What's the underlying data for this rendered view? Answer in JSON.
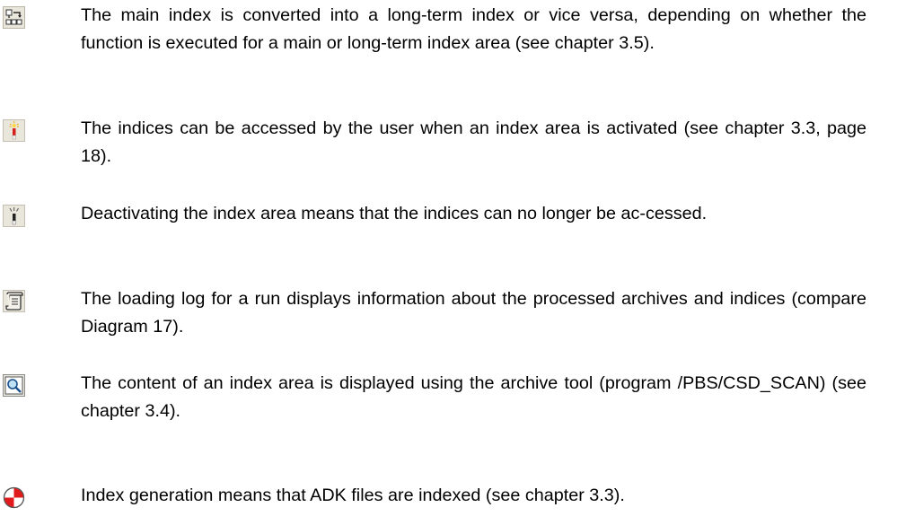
{
  "entries": [
    {
      "icon": "convert-index-icon",
      "text": "The main index is converted into a long-term index or vice versa, depending on whether the function is executed for a main or long-term index area (see chapter 3.5)."
    },
    {
      "icon": "activate-icon",
      "text": "The indices can be accessed by the user when an index area is activated (see chapter 3.3, page 18)."
    },
    {
      "icon": "deactivate-icon",
      "text": "Deactivating the index area means that the indices can no longer be ac-cessed."
    },
    {
      "icon": "log-scroll-icon",
      "text": "The loading log for a run displays information about the processed archives and indices (compare Diagram 17)."
    },
    {
      "icon": "archive-tool-icon",
      "text": "The content of an index area is displayed using the archive tool (program /PBS/CSD_SCAN) (see chapter 3.4)."
    },
    {
      "icon": "index-generation-icon",
      "text": "Index generation means that ADK files are indexed (see chapter 3.3)."
    }
  ]
}
